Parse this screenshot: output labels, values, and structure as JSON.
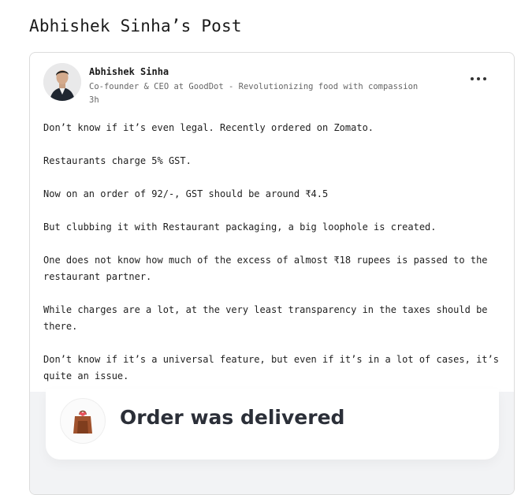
{
  "page": {
    "title": "Abhishek Sinha’s Post"
  },
  "post": {
    "author": {
      "name": "Abhishek Sinha",
      "headline": "Co-founder & CEO at GoodDot - Revolutionizing food with compassion",
      "time": "3h"
    },
    "menu_icon": "more-horizontal-icon",
    "paragraphs": [
      "Don’t know if it’s even legal.  Recently ordered on Zomato.",
      "Restaurants charge 5% GST.",
      "Now on an order of 92/-, GST should be around ₹4.5",
      "But clubbing it with Restaurant packaging, a big loophole is created.",
      "One does not know how much of the excess of almost ₹18 rupees is passed to the restaurant partner.",
      "While charges are a lot, at the very least transparency in the taxes should be there.",
      "Don’t know if it’s a universal feature, but even if it’s in a lot of cases, it’s quite an issue."
    ],
    "media": {
      "status_text": "Order was delivered",
      "icon": "delivery-bag-icon"
    }
  },
  "colors": {
    "heart": "#e8505b",
    "bag": "#a0522d",
    "toast_text": "#2b2f38"
  }
}
